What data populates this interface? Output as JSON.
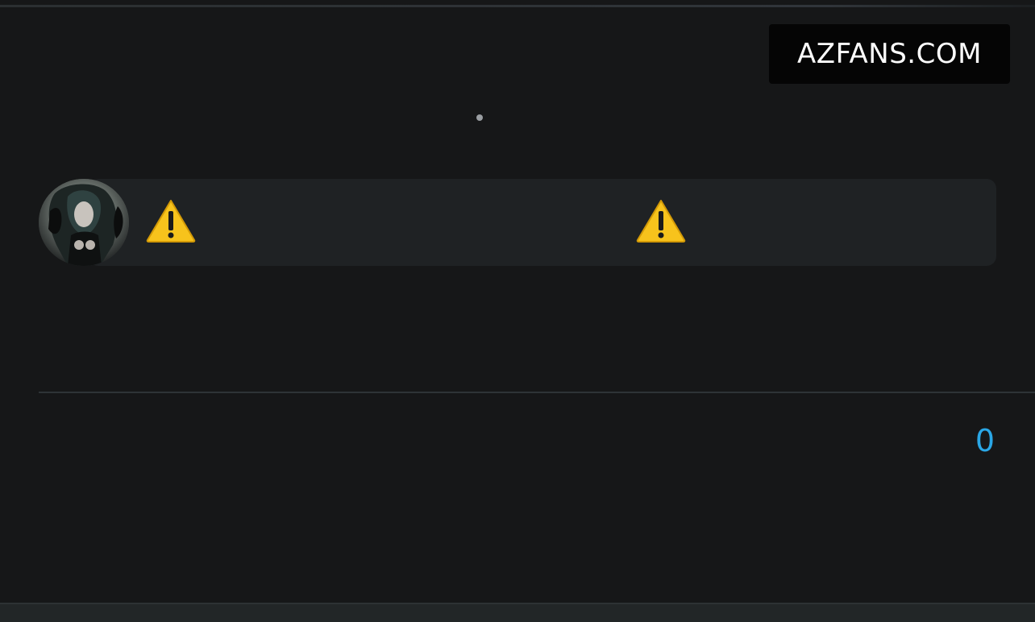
{
  "watermark": {
    "text": "AZFANS.COM"
  },
  "message": {
    "icons": [
      "warning-icon",
      "warning-icon"
    ],
    "warning_color": "#f7c31c"
  },
  "stats": {
    "count": "0",
    "count_color": "#2aa7e6"
  },
  "colors": {
    "background": "#161718",
    "bubble": "#1f2224"
  }
}
